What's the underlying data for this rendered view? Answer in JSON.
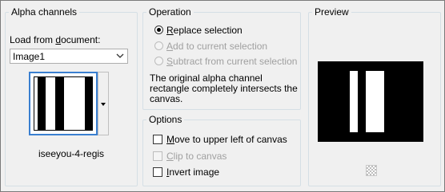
{
  "alpha": {
    "legend": "Alpha channels",
    "load_label_pre": "Load from ",
    "load_label_key": "d",
    "load_label_post": "ocument:",
    "document_value": "Image1",
    "channel_name": "iseeyou-4-regis"
  },
  "operation": {
    "legend": "Operation",
    "options": [
      {
        "key": "R",
        "rest": "eplace selection",
        "selected": true,
        "enabled": true
      },
      {
        "key": "A",
        "rest": "dd to current selection",
        "selected": false,
        "enabled": false
      },
      {
        "key": "S",
        "rest": "ubtract from current selection",
        "selected": false,
        "enabled": false
      }
    ],
    "message_line1": "The original alpha channel",
    "message_line2": "rectangle completely intersects the",
    "message_line3": "canvas."
  },
  "options": {
    "legend": "Options",
    "items": [
      {
        "key": "M",
        "rest": "ove to upper left of canvas",
        "checked": false,
        "enabled": true
      },
      {
        "key": "C",
        "rest": "lip to canvas",
        "checked": false,
        "enabled": false
      },
      {
        "key": "I",
        "rest": "nvert image",
        "checked": false,
        "enabled": true
      }
    ]
  },
  "preview": {
    "legend": "Preview"
  },
  "icons": {
    "dropdown": "chevron-down-icon",
    "thumbnail_dropdown": "caret-down-icon",
    "background": "checkerboard-icon"
  },
  "colors": {
    "selection_border": "#3a7fd0",
    "preview_bg": "#000000"
  }
}
